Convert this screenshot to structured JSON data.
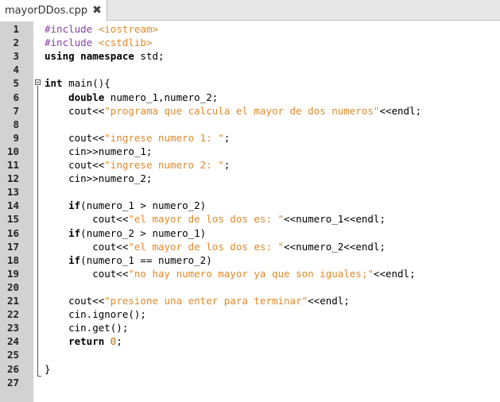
{
  "tab": {
    "title": "mayorDDos.cpp",
    "close_icon": "close-icon"
  },
  "lines": [
    {
      "n": "1",
      "tokens": [
        {
          "t": "#include ",
          "c": "pre"
        },
        {
          "t": "<iostream>",
          "c": "inc"
        }
      ]
    },
    {
      "n": "2",
      "tokens": [
        {
          "t": "#include ",
          "c": "pre"
        },
        {
          "t": "<cstdlib>",
          "c": "inc"
        }
      ]
    },
    {
      "n": "3",
      "tokens": [
        {
          "t": "using",
          "c": "kw"
        },
        {
          "t": " ",
          "c": ""
        },
        {
          "t": "namespace",
          "c": "kw"
        },
        {
          "t": " std;",
          "c": ""
        }
      ]
    },
    {
      "n": "4",
      "tokens": []
    },
    {
      "n": "5",
      "tokens": [
        {
          "t": "int",
          "c": "kw"
        },
        {
          "t": " main(){",
          "c": ""
        }
      ]
    },
    {
      "n": "6",
      "tokens": [
        {
          "t": "    ",
          "c": ""
        },
        {
          "t": "double",
          "c": "kw"
        },
        {
          "t": " numero_1,numero_2;",
          "c": ""
        }
      ]
    },
    {
      "n": "7",
      "tokens": [
        {
          "t": "    cout<<",
          "c": ""
        },
        {
          "t": "\"programa que calcula el mayor de dos numeros\"",
          "c": "str"
        },
        {
          "t": "<<endl;",
          "c": ""
        }
      ]
    },
    {
      "n": "8",
      "tokens": []
    },
    {
      "n": "9",
      "tokens": [
        {
          "t": "    cout<<",
          "c": ""
        },
        {
          "t": "\"ingrese numero 1: \"",
          "c": "str"
        },
        {
          "t": ";",
          "c": ""
        }
      ]
    },
    {
      "n": "10",
      "tokens": [
        {
          "t": "    cin>>numero_1;",
          "c": ""
        }
      ]
    },
    {
      "n": "11",
      "tokens": [
        {
          "t": "    cout<<",
          "c": ""
        },
        {
          "t": "\"ingrese numero 2: \"",
          "c": "str"
        },
        {
          "t": ";",
          "c": ""
        }
      ]
    },
    {
      "n": "12",
      "tokens": [
        {
          "t": "    cin>>numero_2;",
          "c": ""
        }
      ]
    },
    {
      "n": "13",
      "tokens": []
    },
    {
      "n": "14",
      "tokens": [
        {
          "t": "    ",
          "c": ""
        },
        {
          "t": "if",
          "c": "kw"
        },
        {
          "t": "(numero_1 > numero_2)",
          "c": ""
        }
      ]
    },
    {
      "n": "15",
      "tokens": [
        {
          "t": "        cout<<",
          "c": ""
        },
        {
          "t": "\"el mayor de los dos es: \"",
          "c": "str"
        },
        {
          "t": "<<numero_1<<endl;",
          "c": ""
        }
      ]
    },
    {
      "n": "16",
      "tokens": [
        {
          "t": "    ",
          "c": ""
        },
        {
          "t": "if",
          "c": "kw"
        },
        {
          "t": "(numero_2 > numero_1)",
          "c": ""
        }
      ]
    },
    {
      "n": "17",
      "tokens": [
        {
          "t": "        cout<<",
          "c": ""
        },
        {
          "t": "\"el mayor de los dos es: \"",
          "c": "str"
        },
        {
          "t": "<<numero_2<<endl;",
          "c": ""
        }
      ]
    },
    {
      "n": "18",
      "tokens": [
        {
          "t": "    ",
          "c": ""
        },
        {
          "t": "if",
          "c": "kw"
        },
        {
          "t": "(numero_1 == numero_2)",
          "c": ""
        }
      ]
    },
    {
      "n": "19",
      "tokens": [
        {
          "t": "        cout<<",
          "c": ""
        },
        {
          "t": "\"no hay numero mayor ya que son iguales;\"",
          "c": "str"
        },
        {
          "t": "<<endl;",
          "c": ""
        }
      ]
    },
    {
      "n": "20",
      "tokens": []
    },
    {
      "n": "21",
      "tokens": [
        {
          "t": "    cout<<",
          "c": ""
        },
        {
          "t": "\"presione una enter para terminar\"",
          "c": "str"
        },
        {
          "t": "<<endl;",
          "c": ""
        }
      ]
    },
    {
      "n": "22",
      "tokens": [
        {
          "t": "    cin.ignore();",
          "c": ""
        }
      ]
    },
    {
      "n": "23",
      "tokens": [
        {
          "t": "    cin.get();",
          "c": ""
        }
      ]
    },
    {
      "n": "24",
      "tokens": [
        {
          "t": "    ",
          "c": ""
        },
        {
          "t": "return",
          "c": "kw"
        },
        {
          "t": " ",
          "c": ""
        },
        {
          "t": "0",
          "c": "num"
        },
        {
          "t": ";",
          "c": ""
        }
      ]
    },
    {
      "n": "25",
      "tokens": []
    },
    {
      "n": "26",
      "tokens": [
        {
          "t": "}",
          "c": ""
        }
      ]
    },
    {
      "n": "27",
      "tokens": []
    }
  ]
}
